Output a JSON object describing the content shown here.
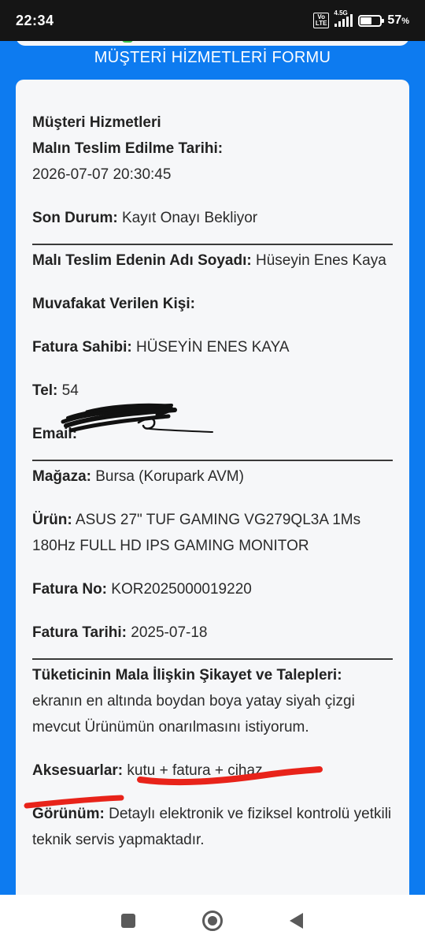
{
  "status_bar": {
    "time": "22:34",
    "volte_line1": "Vo",
    "volte_line2": "LTE",
    "network": "4.5G",
    "battery_percent": "57",
    "battery_unit": "%",
    "battery_level": 0.57
  },
  "form": {
    "title": "MÜŞTERİ HİZMETLERİ FORMU",
    "section_title": "Müşteri Hizmetleri",
    "delivery_date_label": "Malın Teslim Edilme Tarihi:",
    "delivery_date_value": "2026-07-07 20:30:45",
    "status_label": "Son Durum:",
    "status_value": "Kayıt Onayı Bekliyor",
    "deliverer_label": "Malı Teslim Edenin Adı Soyadı:",
    "deliverer_value": "Hüseyin Enes Kaya",
    "consent_label": "Muvafakat Verilen Kişi:",
    "consent_value": "",
    "invoice_owner_label": "Fatura Sahibi:",
    "invoice_owner_value": "HÜSEYİN ENES KAYA",
    "phone_label": "Tel:",
    "phone_value": "54",
    "email_label": "Email:",
    "email_value": "",
    "store_label": "Mağaza:",
    "store_value": "Bursa (Korupark AVM)",
    "product_label": "Ürün:",
    "product_value": "ASUS 27\" TUF GAMING VG279QL3A 1Ms 180Hz FULL HD IPS GAMING MONITOR",
    "invoice_no_label": "Fatura No:",
    "invoice_no_value": "KOR2025000019220",
    "invoice_date_label": "Fatura Tarihi:",
    "invoice_date_value": "2025-07-18",
    "complaint_label": "Tüketicinin Mala İlişkin Şikayet ve Talepleri:",
    "complaint_value": "ekranın en altında boydan boya yatay siyah çizgi mevcut Ürünümün onarılmasını istiyorum.",
    "accessories_label": "Aksesuarlar:",
    "accessories_value": "kutu + fatura + cihaz",
    "appearance_label": "Görünüm:",
    "appearance_value": "Detaylı elektronik ve fiziksel kontrolü yetkili teknik servis yapmaktadır."
  },
  "colors": {
    "page_background": "#0d7bf0",
    "card_background": "#f6f7f9",
    "annotation_red": "#e8231a",
    "redaction_black": "#111111"
  },
  "nav_bar": {
    "icons": [
      "recent-apps-icon",
      "home-icon",
      "back-icon"
    ]
  }
}
